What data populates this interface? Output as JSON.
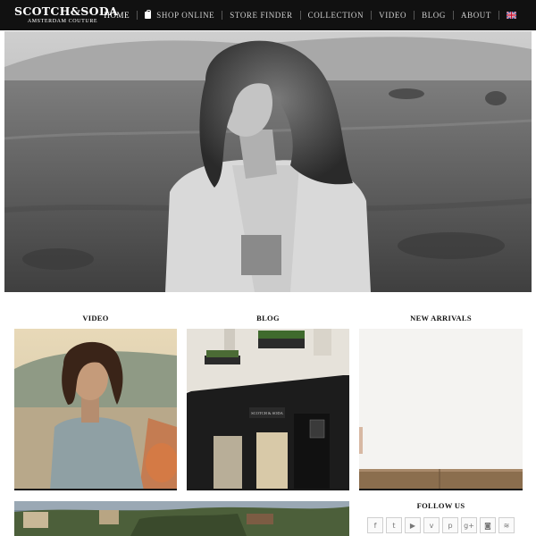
{
  "brand": {
    "logo_main": "SCOTCH&SODA",
    "logo_sub": "AMSTERDAM COUTURE"
  },
  "nav": {
    "items": [
      {
        "label": "HOME",
        "active": true
      },
      {
        "label": "SHOP ONLINE",
        "icon": "shopping-bag-icon"
      },
      {
        "label": "STORE FINDER"
      },
      {
        "label": "COLLECTION"
      },
      {
        "label": "VIDEO"
      },
      {
        "label": "BLOG"
      },
      {
        "label": "ABOUT"
      }
    ],
    "language_icon": "uk-flag-icon"
  },
  "sections": {
    "video": {
      "title": "VIDEO"
    },
    "blog": {
      "title": "BLOG"
    },
    "new_arrivals": {
      "title": "NEW ARRIVALS"
    },
    "follow_us": {
      "title": "FOLLOW US"
    }
  },
  "shop_sign": "SCOTCH & SODA",
  "social_icons": [
    "facebook-icon",
    "twitter-icon",
    "youtube-icon",
    "vimeo-icon",
    "pinterest-icon",
    "google-plus-icon",
    "instagram-icon",
    "rss-icon"
  ],
  "social_glyphs": [
    "f",
    "t",
    "▶",
    "v",
    "p",
    "g+",
    "◙",
    "≋"
  ],
  "colors": {
    "header_bg": "#111111",
    "nav_text": "#cfcfcf",
    "nav_active": "#ffffff"
  }
}
